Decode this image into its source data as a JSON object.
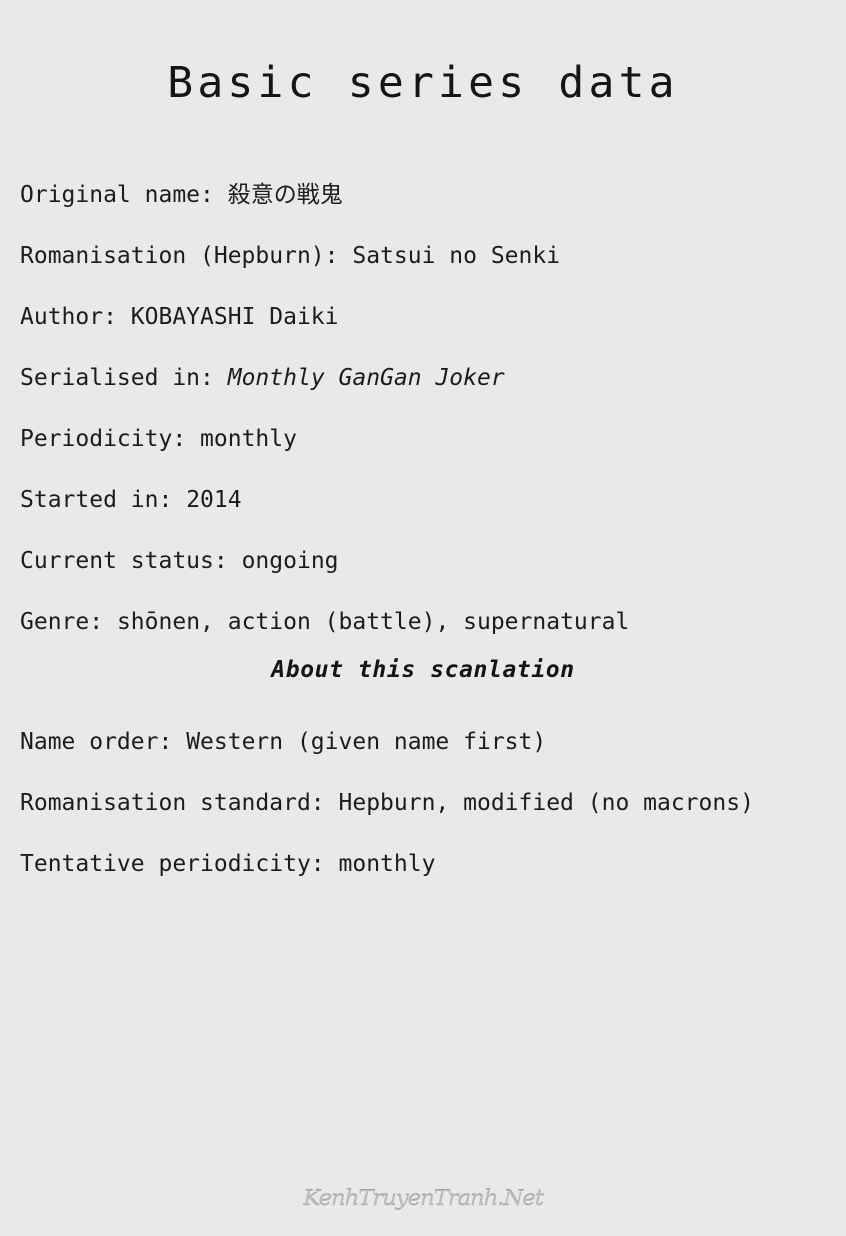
{
  "page": {
    "title": "Basic series data",
    "background_color": "#e8eaea",
    "text_color": "#1a1a1a"
  },
  "series_info": {
    "lines": [
      {
        "label": "Original name:",
        "value": "殺意の戦鬼",
        "italic": false
      },
      {
        "label": "Romanisation (Hepburn):",
        "value": "Satsui no Senki",
        "italic": false
      },
      {
        "label": "Author:",
        "value": "KOBAYASHI Daiki",
        "italic": false
      },
      {
        "label": "Serialised in:",
        "value": "Monthly GanGan Joker",
        "italic": true
      },
      {
        "label": "Periodicity:",
        "value": "monthly",
        "italic": false
      },
      {
        "label": "Started in:",
        "value": "2014",
        "italic": false
      },
      {
        "label": "Current status:",
        "value": "ongoing",
        "italic": false
      },
      {
        "label": "Genre:",
        "value": "shōnen, action (battle), supernatural",
        "italic": false
      }
    ]
  },
  "scanlation": {
    "heading": "About this scanlation",
    "lines": [
      {
        "label": "Name order:",
        "value": "Western (given name first)",
        "italic": false
      },
      {
        "label": "Romanisation standard:",
        "value": "Hepburn, modified (no macrons)",
        "italic": false
      },
      {
        "label": "Tentative periodicity:",
        "value": "monthly",
        "italic": false
      }
    ]
  },
  "watermark": {
    "text": "KenhTruyenTranh.Net",
    "color": "#b9bcbc"
  }
}
